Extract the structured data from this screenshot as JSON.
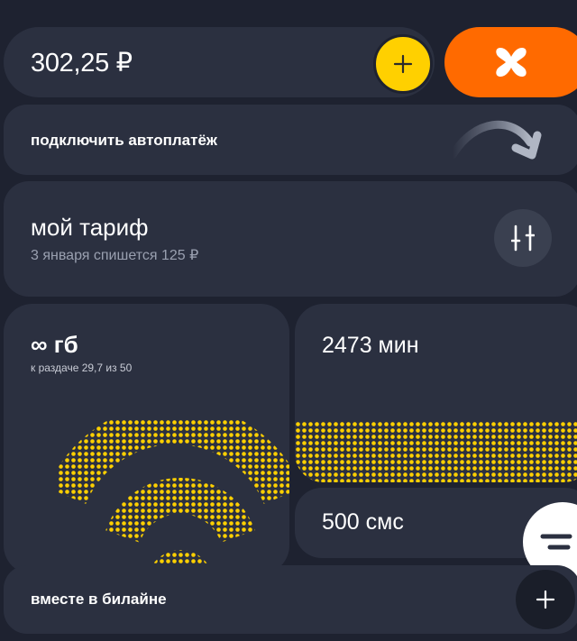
{
  "balance": {
    "amount": "302,25 ₽"
  },
  "autopay": {
    "label": "подключить автоплатёж"
  },
  "tariff": {
    "title": "мой тариф",
    "subtitle": "3 января спишется 125 ₽"
  },
  "internet": {
    "title": "∞ гб",
    "subtitle": "к раздаче 29,7 из 50"
  },
  "minutes": {
    "title": "2473 мин"
  },
  "sms": {
    "title": "500 смс"
  },
  "together": {
    "label": "вместе в билайне"
  },
  "icons": {
    "topup": "plus-icon",
    "brand": "beeline-logo-icon",
    "autopay": "curved-arrow-icon",
    "tariff_settings": "sliders-icon",
    "internet": "wifi-dots-icon",
    "chat": "chat-bubble-icon",
    "together_add": "plus-icon"
  },
  "colors": {
    "background": "#1e2230",
    "card": "#2b3040",
    "accent_yellow": "#ffd000",
    "accent_orange": "#ff6a00",
    "text_secondary": "#9aa0b0"
  }
}
